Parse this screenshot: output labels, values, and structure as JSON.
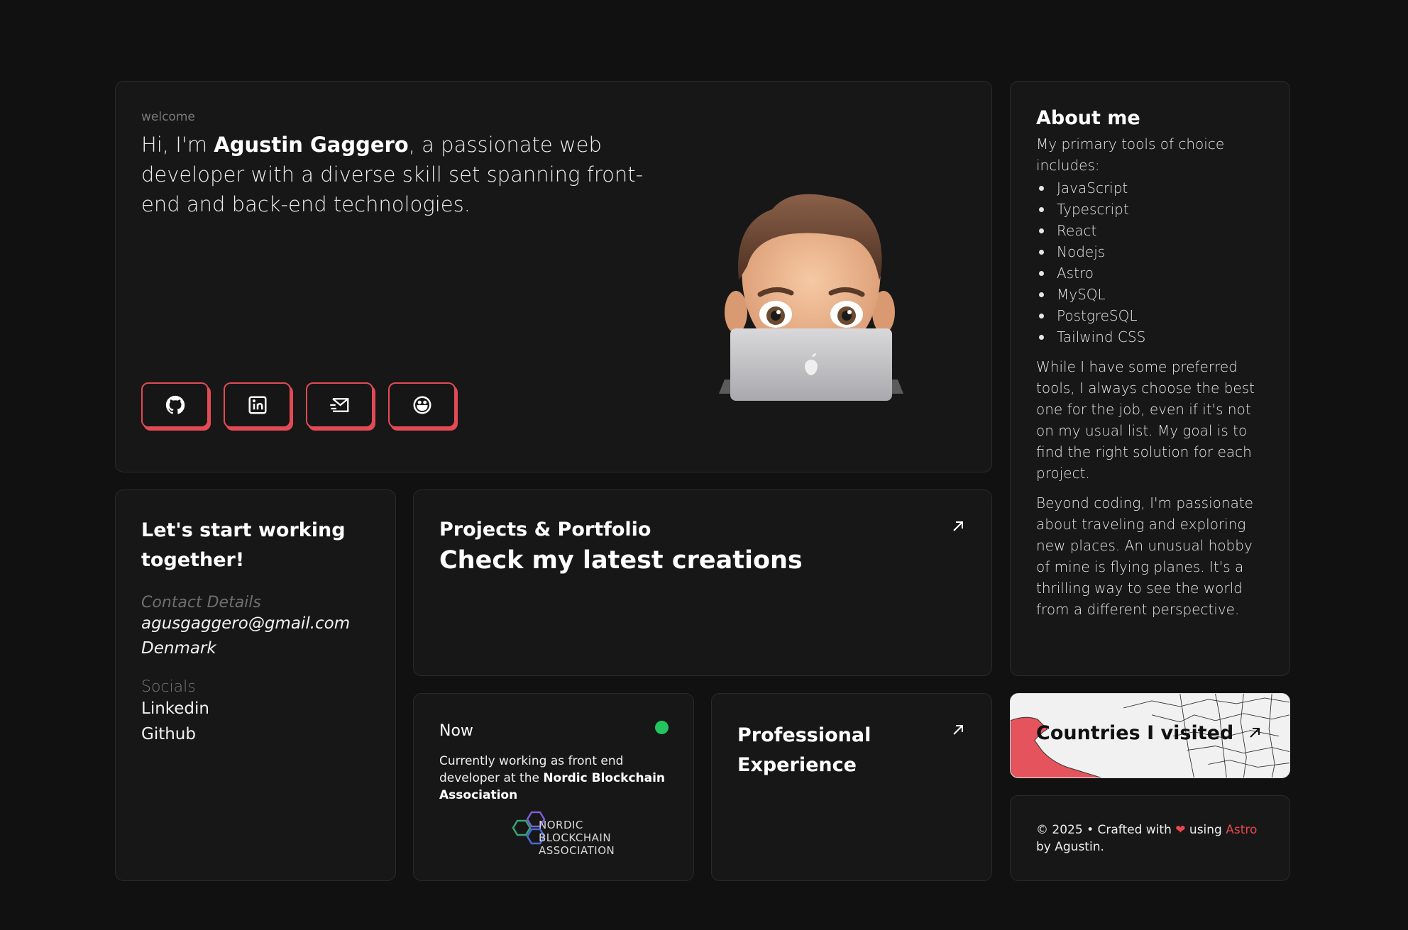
{
  "hero": {
    "eyebrow": "welcome",
    "intro_prefix": "Hi, I'm ",
    "name": "Agustin Gaggero",
    "intro_suffix": ", a passionate web developer with a diverse skill set spanning front-end and back-end technologies.",
    "socials": [
      {
        "icon": "github-icon"
      },
      {
        "icon": "linkedin-icon"
      },
      {
        "icon": "mail-icon"
      },
      {
        "icon": "smiley-icon"
      }
    ]
  },
  "about": {
    "title": "About me",
    "tools_intro": "My primary tools of choice includes:",
    "tools": [
      "JavaScript",
      "Typescript",
      "React",
      "Nodejs",
      "Astro",
      "MySQL",
      "PostgreSQL",
      "Tailwind CSS"
    ],
    "paragraph1": "While I have some preferred tools, I always choose the best one for the job, even if it's not on my usual list. My goal is to find the right solution for each project.",
    "paragraph2": "Beyond coding, I'm passionate about traveling and exploring new places. An unusual hobby of mine is flying planes. It's a thrilling way to see the world from a different perspective."
  },
  "contact": {
    "title": "Let's start working together!",
    "details_label": "Contact Details",
    "email": "agusgaggero@gmail.com",
    "country": "Denmark",
    "socials_label": "Socials",
    "links": [
      "Linkedin",
      "Github"
    ]
  },
  "projects": {
    "subtitle": "Projects & Portfolio",
    "title": "Check my latest creations"
  },
  "now": {
    "title": "Now",
    "desc_prefix": "Currently working as front end developer at the ",
    "company": "Nordic Blockchain Association",
    "logo_text": [
      "NORDIC",
      "BLOCKCHAIN",
      "ASSOCIATION"
    ],
    "status_color": "#22c55e"
  },
  "experience": {
    "title": "Professional Experience"
  },
  "countries": {
    "title": "Countries I visited"
  },
  "footer": {
    "prefix": "© 2025 • Crafted with ",
    "heart": "❤",
    "middle": " using ",
    "astro": "Astro",
    "suffix": " by Agustin."
  },
  "colors": {
    "accent": "#e24a55",
    "background": "#111111",
    "card": "#171717"
  }
}
